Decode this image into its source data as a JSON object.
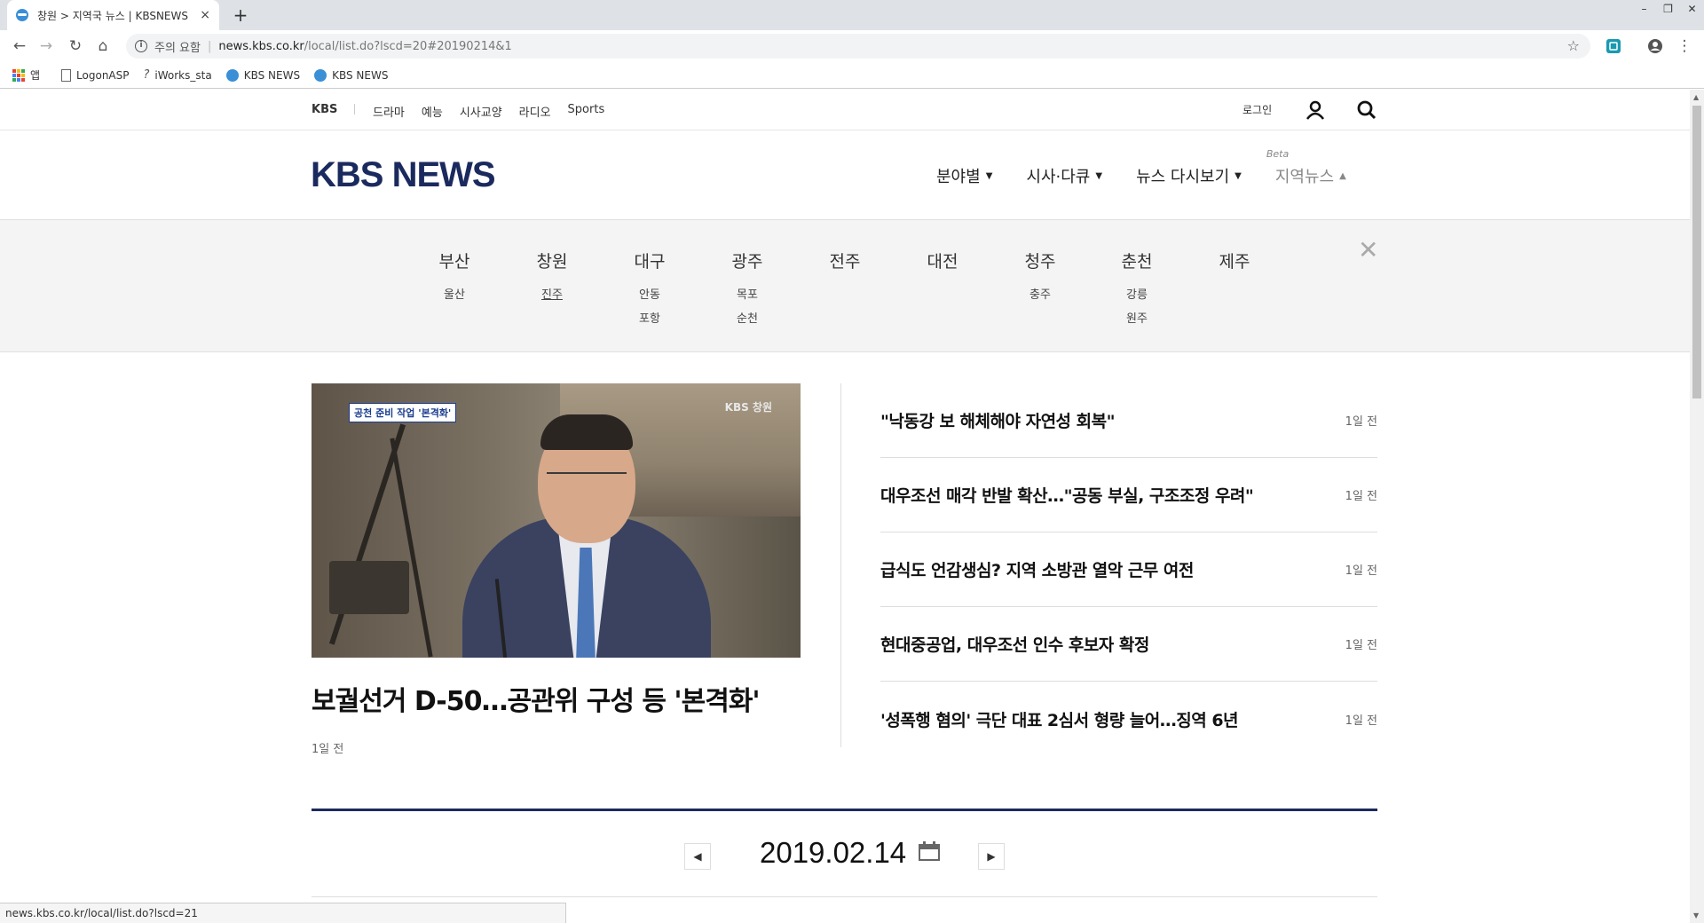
{
  "browser": {
    "tab_title": "창원 > 지역국 뉴스 | KBSNEWS",
    "tab_close": "×",
    "new_tab": "+",
    "security_label": "주의 요함",
    "url_host": "news.kbs.co.kr",
    "url_path": "/local/list.do?lscd=20#20190214&1",
    "bookmarks": [
      {
        "label": "앱",
        "icon": "apps-icon"
      },
      {
        "label": "LogonASP",
        "icon": "document-icon"
      },
      {
        "label": "iWorks_sta",
        "icon": "iworks-icon"
      },
      {
        "label": "KBS NEWS",
        "icon": "kbs-icon"
      },
      {
        "label": "KBS NEWS",
        "icon": "kbs-icon"
      }
    ],
    "status_url": "news.kbs.co.kr/local/list.do?lscd=21"
  },
  "gnb": {
    "brand": "KBS",
    "menu": [
      "드라마",
      "예능",
      "시사교양",
      "라디오",
      "Sports"
    ],
    "login": "로그인"
  },
  "header": {
    "logo": "KBS NEWS",
    "nav": [
      {
        "label": "분야별",
        "caret": "▼"
      },
      {
        "label": "시사·다큐",
        "caret": "▼"
      },
      {
        "label": "뉴스 다시보기",
        "caret": "▼"
      },
      {
        "label": "지역뉴스",
        "caret": "▲",
        "badge": "Beta"
      }
    ]
  },
  "regions": [
    {
      "name": "부산",
      "subs": [
        "울산"
      ]
    },
    {
      "name": "창원",
      "subs": [
        "진주"
      ]
    },
    {
      "name": "대구",
      "subs": [
        "안동",
        "포항"
      ]
    },
    {
      "name": "광주",
      "subs": [
        "목포",
        "순천"
      ]
    },
    {
      "name": "전주",
      "subs": []
    },
    {
      "name": "대전",
      "subs": []
    },
    {
      "name": "청주",
      "subs": [
        "충주"
      ]
    },
    {
      "name": "춘천",
      "subs": [
        "강릉",
        "원주"
      ]
    },
    {
      "name": "제주",
      "subs": []
    }
  ],
  "region_close": "✕",
  "lead": {
    "image_caption": "공천 준비 작업 '본격화'",
    "image_watermark": "KBS 창원",
    "title": "보궐선거 D-50…공관위 구성 등 '본격화'",
    "time": "1일 전"
  },
  "news_list": [
    {
      "title": "\"낙동강 보 해체해야 자연성 회복\"",
      "time": "1일 전"
    },
    {
      "title": "대우조선 매각 반발 확산…\"공동 부실, 구조조정 우려\"",
      "time": "1일 전"
    },
    {
      "title": "급식도 언감생심? 지역 소방관 열악 근무 여전",
      "time": "1일 전"
    },
    {
      "title": "현대중공업, 대우조선 인수 후보자 확정",
      "time": "1일 전"
    },
    {
      "title": "'성폭행 혐의' 극단 대표 2심서 형량 늘어…징역 6년",
      "time": "1일 전"
    }
  ],
  "date_nav": {
    "date": "2019.02.14",
    "prev": "◀",
    "next": "▶"
  },
  "colors": {
    "brand_navy": "#1b2a5e",
    "tab_bar": "#dee1e6"
  }
}
